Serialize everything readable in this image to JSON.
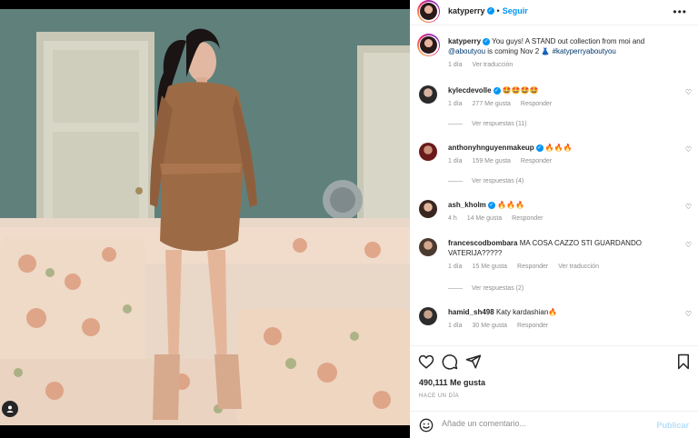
{
  "post": {
    "username": "katyperry",
    "follow_label": "Seguir",
    "more_label": "•••",
    "caption_user": "katyperry",
    "caption_text": "You guys! A STAND out collection from moi and",
    "caption_mention": "@aboutyou",
    "caption_text2": "is coming Nov 2 👗",
    "caption_hashtag": "#katyperryaboutyou",
    "caption_time": "1 día",
    "caption_translate": "Ver traducción"
  },
  "comments": [
    {
      "user": "kylecdevolle",
      "text": "🤩🤩🤩🤩",
      "time": "1 día",
      "likes": "277 Me gusta",
      "reply": "Responder",
      "translate": "",
      "replies": "Ver respuestas (11)"
    },
    {
      "user": "anthonyhnguyenmakeup",
      "text": "🔥🔥🔥",
      "time": "1 día",
      "likes": "159 Me gusta",
      "reply": "Responder",
      "translate": "",
      "replies": "Ver respuestas (4)"
    },
    {
      "user": "ash_kholm",
      "text": "🔥🔥🔥",
      "time": "4 h",
      "likes": "14 Me gusta",
      "reply": "Responder",
      "translate": "",
      "replies": ""
    },
    {
      "user": "francescodbombara",
      "text": "MA COSA CAZZO STI GUARDANDO VATERIJA?????",
      "time": "1 día",
      "likes": "15 Me gusta",
      "reply": "Responder",
      "translate": "Ver traducción",
      "replies": "Ver respuestas (2)"
    },
    {
      "user": "hamid_sh498",
      "text": "Katy kardashian🔥",
      "time": "1 día",
      "likes": "30 Me gusta",
      "reply": "Responder",
      "translate": "",
      "replies": ""
    }
  ],
  "stats": {
    "likes": "490,111 Me gusta",
    "ago": "HACE UN DÍA"
  },
  "compose": {
    "placeholder": "Añade un comentario...",
    "publish": "Publicar"
  },
  "icons": [
    "heart-icon",
    "comment-icon",
    "share-icon",
    "bookmark-icon",
    "emoji-icon",
    "verified-icon",
    "more-icon",
    "user-icon"
  ]
}
